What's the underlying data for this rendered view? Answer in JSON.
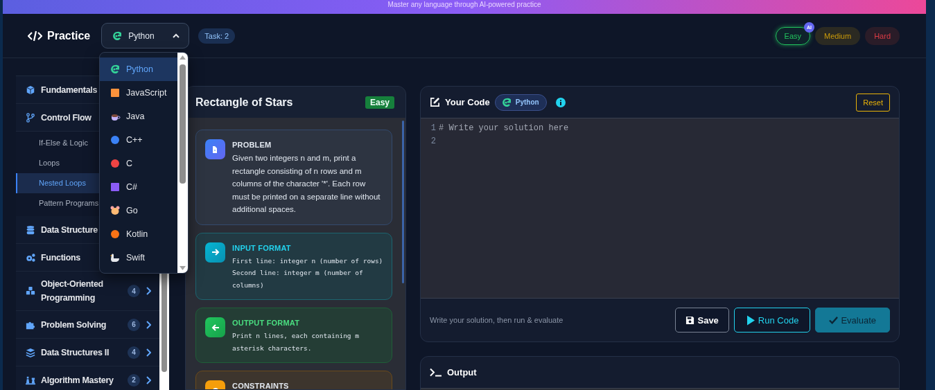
{
  "banner": {
    "text": "Master any language through AI-powered practice"
  },
  "header": {
    "title": "Practice",
    "language": "Python",
    "task": "Task: 2",
    "ai_badge": "AI",
    "difficulties": [
      {
        "label": "Easy",
        "kind": "easy",
        "selected": true
      },
      {
        "label": "Medium",
        "kind": "medium",
        "selected": false
      },
      {
        "label": "Hard",
        "kind": "hard",
        "selected": false
      }
    ]
  },
  "language_menu": {
    "items": [
      {
        "label": "Python",
        "kind": "python",
        "selected": true
      },
      {
        "label": "JavaScript",
        "kind": "javascript",
        "selected": false
      },
      {
        "label": "Java",
        "kind": "java",
        "selected": false
      },
      {
        "label": "C++",
        "kind": "cpp",
        "selected": false
      },
      {
        "label": "C",
        "kind": "c",
        "selected": false
      },
      {
        "label": "C#",
        "kind": "csharp",
        "selected": false
      },
      {
        "label": "Go",
        "kind": "go",
        "selected": false
      },
      {
        "label": "Kotlin",
        "kind": "kotlin",
        "selected": false
      },
      {
        "label": "Swift",
        "kind": "swift",
        "selected": false
      }
    ]
  },
  "sidebar": {
    "items": [
      {
        "label": "Fundamentals",
        "kind": "cube"
      },
      {
        "label": "Control Flow",
        "kind": "branch",
        "children": [
          {
            "label": "If-Else & Logic",
            "selected": false
          },
          {
            "label": "Loops",
            "selected": false
          },
          {
            "label": "Nested Loops",
            "selected": true
          },
          {
            "label": "Pattern Programs",
            "selected": false
          }
        ]
      },
      {
        "label": "Data Structure",
        "kind": "database"
      },
      {
        "label": "Functions",
        "kind": "gears"
      },
      {
        "label": "Object-Oriented Programming",
        "kind": "cubes",
        "count": "4"
      },
      {
        "label": "Problem Solving",
        "kind": "puzzle",
        "count": "6"
      },
      {
        "label": "Data Structures II",
        "kind": "layers",
        "count": "4"
      },
      {
        "label": "Algorithm Mastery",
        "kind": "chess",
        "count": "2"
      }
    ]
  },
  "problem": {
    "title": "Rectangle of Stars",
    "difficulty": "Easy",
    "sections": [
      {
        "kind": "problem",
        "heading": "PROBLEM",
        "text": "Given two integers n and m, print a rectangle consisting of n rows and m columns of the character '*'. Each row must be printed on a separate line without additional spaces."
      },
      {
        "kind": "input",
        "heading": "INPUT FORMAT",
        "text": "First line: integer n (number of rows) Second line: integer m (number of columns)"
      },
      {
        "kind": "output",
        "heading": "OUTPUT FORMAT",
        "text": "Print n lines, each containing m asterisk characters."
      },
      {
        "kind": "constraints",
        "heading": "CONSTRAINTS"
      }
    ]
  },
  "editor": {
    "title": "Your Code",
    "language": "Python",
    "reset": "Reset",
    "lines": [
      {
        "number": "1",
        "code": "# Write your solution here"
      },
      {
        "number": "2"
      }
    ],
    "hint": "Write your solution, then run & evaluate",
    "buttons": [
      {
        "label": "Save",
        "kind": "save"
      },
      {
        "label": "Run Code",
        "kind": "run"
      },
      {
        "label": "Evaluate",
        "kind": "evaluate"
      }
    ]
  },
  "output": {
    "title": "Output"
  }
}
